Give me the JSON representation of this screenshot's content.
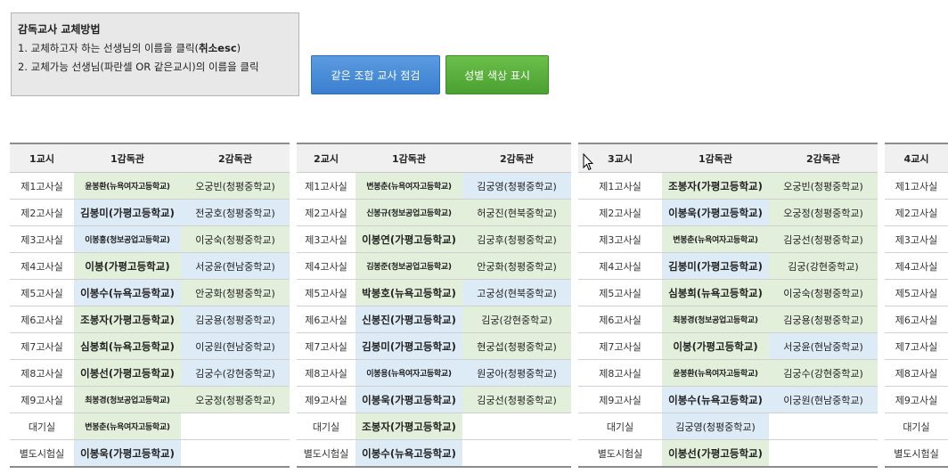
{
  "info": {
    "title": "감독교사 교체방법",
    "line1_pre": "1. 교체하고자 하는 선생님의 이름을 클릭(",
    "line1_bold": "취소esc",
    "line1_post": ")",
    "line2": "2. 교체가능 선생님(파란셀 OR 같은교시)의 이름을 클릭"
  },
  "buttons": {
    "check": "같은 조합 교사 점검",
    "gender": "성별 색상 표시"
  },
  "colors": {
    "green": "#e2efda",
    "blue": "#ddebf7",
    "button_blue": "#4a8ad6",
    "button_green": "#58b03a"
  },
  "tables": [
    {
      "period": "1교시",
      "h1": "1감독관",
      "h2": "2감독관",
      "rows": [
        {
          "room": "제1고사실",
          "a": "윤봉환(뉴욕여자고등학교)",
          "as": "tiny",
          "ac": "green",
          "b": "오궁빈(청평중학교)",
          "bs": "",
          "bc": "green"
        },
        {
          "room": "제2고사실",
          "a": "김봉미(가평고등학교)",
          "as": "bold",
          "ac": "blue",
          "b": "전궁호(청평중학교)",
          "bs": "",
          "bc": "blue"
        },
        {
          "room": "제3고사실",
          "a": "이봉홍(청보공업고등학교)",
          "as": "tiny",
          "ac": "blue",
          "b": "이궁숙(청평중학교)",
          "bs": "",
          "bc": "green"
        },
        {
          "room": "제4고사실",
          "a": "이봉(가평고등학교)",
          "as": "bold",
          "ac": "green",
          "b": "서궁윤(현남중학교)",
          "bs": "",
          "bc": "blue"
        },
        {
          "room": "제5고사실",
          "a": "이봉수(뉴욕고등학교)",
          "as": "bold",
          "ac": "blue",
          "b": "안궁화(청평중학교)",
          "bs": "",
          "bc": "green"
        },
        {
          "room": "제6고사실",
          "a": "조봉자(가평고등학교)",
          "as": "bold",
          "ac": "green",
          "b": "김궁용(청평중학교)",
          "bs": "",
          "bc": "blue"
        },
        {
          "room": "제7고사실",
          "a": "심봉희(뉴욕고등학교)",
          "as": "bold",
          "ac": "green",
          "b": "이궁원(현남중학교)",
          "bs": "",
          "bc": "blue"
        },
        {
          "room": "제8고사실",
          "a": "이봉선(가평고등학교)",
          "as": "bold",
          "ac": "green",
          "b": "김궁수(강현중학교)",
          "bs": "",
          "bc": "blue"
        },
        {
          "room": "제9고사실",
          "a": "최봉경(청보공업고등학교)",
          "as": "tiny",
          "ac": "green",
          "b": "오궁정(청평중학교)",
          "bs": "",
          "bc": "green"
        },
        {
          "room": "대기실",
          "a": "변봉춘(뉴욕여자고등학교)",
          "as": "tiny",
          "ac": "green",
          "b": "",
          "bs": "",
          "bc": "none"
        },
        {
          "room": "별도시험실",
          "a": "이봉욱(가평고등학교)",
          "as": "bold",
          "ac": "blue",
          "b": "",
          "bs": "",
          "bc": "none"
        }
      ]
    },
    {
      "period": "2교시",
      "h1": "1감독관",
      "h2": "2감독관",
      "rows": [
        {
          "room": "제1고사실",
          "a": "변봉춘(뉴욕여자고등학교)",
          "as": "tiny",
          "ac": "green",
          "b": "김궁영(청평중학교)",
          "bs": "",
          "bc": "blue"
        },
        {
          "room": "제2고사실",
          "a": "신봉규(청보공업고등학교)",
          "as": "tiny",
          "ac": "green",
          "b": "허궁진(현북중학교)",
          "bs": "",
          "bc": "green"
        },
        {
          "room": "제3고사실",
          "a": "이봉연(가평고등학교)",
          "as": "bold",
          "ac": "green",
          "b": "김궁후(청평중학교)",
          "bs": "",
          "bc": "green"
        },
        {
          "room": "제4고사실",
          "a": "김봉준(청보공업고등학교)",
          "as": "tiny",
          "ac": "green",
          "b": "안궁화(청평중학교)",
          "bs": "",
          "bc": "green"
        },
        {
          "room": "제5고사실",
          "a": "박봉호(뉴욕고등학교)",
          "as": "bold",
          "ac": "green",
          "b": "고궁성(현북중학교)",
          "bs": "",
          "bc": "blue"
        },
        {
          "room": "제6고사실",
          "a": "신봉진(가평고등학교)",
          "as": "bold",
          "ac": "blue",
          "b": "김궁(강현중학교)",
          "bs": "",
          "bc": "green"
        },
        {
          "room": "제7고사실",
          "a": "김봉미(가평고등학교)",
          "as": "bold",
          "ac": "blue",
          "b": "현궁섭(청평중학교)",
          "bs": "",
          "bc": "green"
        },
        {
          "room": "제8고사실",
          "a": "이봉용(뉴욕여자고등학교)",
          "as": "tiny",
          "ac": "blue",
          "b": "원궁아(청평중학교)",
          "bs": "",
          "bc": "blue"
        },
        {
          "room": "제9고사실",
          "a": "이봉욱(가평고등학교)",
          "as": "bold",
          "ac": "blue",
          "b": "김궁선(청평중학교)",
          "bs": "",
          "bc": "green"
        },
        {
          "room": "대기실",
          "a": "조봉자(가평고등학교)",
          "as": "bold",
          "ac": "green",
          "b": "",
          "bs": "",
          "bc": "none"
        },
        {
          "room": "별도시험실",
          "a": "이봉수(뉴욕고등학교)",
          "as": "bold",
          "ac": "blue",
          "b": "",
          "bs": "",
          "bc": "none"
        }
      ]
    },
    {
      "period": "3교시",
      "h1": "1감독관",
      "h2": "2감독관",
      "rows": [
        {
          "room": "제1고사실",
          "a": "조봉자(가평고등학교)",
          "as": "bold",
          "ac": "green",
          "b": "오궁빈(청평중학교)",
          "bs": "",
          "bc": "green"
        },
        {
          "room": "제2고사실",
          "a": "이봉욱(가평고등학교)",
          "as": "bold",
          "ac": "blue",
          "b": "오궁정(청평중학교)",
          "bs": "",
          "bc": "green"
        },
        {
          "room": "제3고사실",
          "a": "변봉춘(뉴욕여자고등학교)",
          "as": "tiny",
          "ac": "green",
          "b": "김궁선(청평중학교)",
          "bs": "",
          "bc": "green"
        },
        {
          "room": "제4고사실",
          "a": "김봉미(가평고등학교)",
          "as": "bold",
          "ac": "blue",
          "b": "김궁(강현중학교)",
          "bs": "",
          "bc": "green"
        },
        {
          "room": "제5고사실",
          "a": "심봉희(뉴욕고등학교)",
          "as": "bold",
          "ac": "green",
          "b": "이궁숙(청평중학교)",
          "bs": "",
          "bc": "green"
        },
        {
          "room": "제6고사실",
          "a": "최봉경(청보공업고등학교)",
          "as": "tiny",
          "ac": "green",
          "b": "김궁용(청평중학교)",
          "bs": "",
          "bc": "green"
        },
        {
          "room": "제7고사실",
          "a": "이봉(가평고등학교)",
          "as": "bold",
          "ac": "green",
          "b": "서궁윤(현남중학교)",
          "bs": "",
          "bc": "blue"
        },
        {
          "room": "제8고사실",
          "a": "윤봉환(뉴욕여자고등학교)",
          "as": "tiny",
          "ac": "green",
          "b": "김궁수(강현중학교)",
          "bs": "",
          "bc": "green"
        },
        {
          "room": "제9고사실",
          "a": "이봉수(뉴욕고등학교)",
          "as": "bold",
          "ac": "blue",
          "b": "이궁원(현남중학교)",
          "bs": "",
          "bc": "blue"
        },
        {
          "room": "대기실",
          "a": "김궁영(청평중학교)",
          "as": "",
          "ac": "blue",
          "b": "",
          "bs": "",
          "bc": "none"
        },
        {
          "room": "별도시험실",
          "a": "이봉선(가평고등학교)",
          "as": "bold",
          "ac": "green",
          "b": "",
          "bs": "",
          "bc": "none"
        }
      ]
    },
    {
      "period": "4교시",
      "rows": [
        {
          "room": "제1고사실"
        },
        {
          "room": "제2고사실"
        },
        {
          "room": "제3고사실"
        },
        {
          "room": "제4고사실"
        },
        {
          "room": "제5고사실"
        },
        {
          "room": "제6고사실"
        },
        {
          "room": "제7고사실"
        },
        {
          "room": "제8고사실"
        },
        {
          "room": "제9고사실"
        },
        {
          "room": "대기실"
        },
        {
          "room": "별도시험실"
        }
      ]
    }
  ]
}
